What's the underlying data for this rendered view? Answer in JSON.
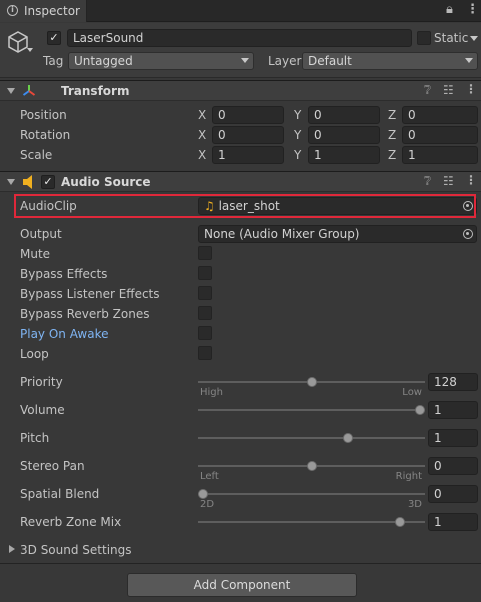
{
  "window": {
    "tab_title": "Inspector"
  },
  "header": {
    "object_name": "LaserSound",
    "static_label": "Static",
    "tag_label": "Tag",
    "tag_value": "Untagged",
    "layer_label": "Layer",
    "layer_value": "Default"
  },
  "transform": {
    "title": "Transform",
    "rows": [
      {
        "label": "Position",
        "x": "0",
        "y": "0",
        "z": "0"
      },
      {
        "label": "Rotation",
        "x": "0",
        "y": "0",
        "z": "0"
      },
      {
        "label": "Scale",
        "x": "1",
        "y": "1",
        "z": "1"
      }
    ],
    "axis": {
      "x": "X",
      "y": "Y",
      "z": "Z"
    }
  },
  "audio_source": {
    "title": "Audio Source",
    "audio_clip_label": "AudioClip",
    "audio_clip_value": "laser_shot",
    "output_label": "Output",
    "output_value": "None (Audio Mixer Group)",
    "mute_label": "Mute",
    "bypass_effects_label": "Bypass Effects",
    "bypass_listener_label": "Bypass Listener Effects",
    "bypass_reverb_label": "Bypass Reverb Zones",
    "play_on_awake_label": "Play On Awake",
    "loop_label": "Loop",
    "priority": {
      "label": "Priority",
      "value": "128",
      "min_label": "High",
      "max_label": "Low",
      "fraction": 0.5
    },
    "volume": {
      "label": "Volume",
      "value": "1",
      "fraction": 1.0
    },
    "pitch": {
      "label": "Pitch",
      "value": "1",
      "fraction": 0.67
    },
    "stereo_pan": {
      "label": "Stereo Pan",
      "value": "0",
      "min_label": "Left",
      "max_label": "Right",
      "fraction": 0.5
    },
    "spatial_blend": {
      "label": "Spatial Blend",
      "value": "0",
      "min_label": "2D",
      "max_label": "3D",
      "fraction": 0.0
    },
    "reverb_zone_mix": {
      "label": "Reverb Zone Mix",
      "value": "1",
      "fraction": 0.91
    },
    "sound_settings_label": "3D Sound Settings"
  },
  "footer": {
    "add_component_label": "Add Component"
  },
  "colors": {
    "background": "#383838",
    "highlight": "#e0283a",
    "link_blue": "#7fb4f2",
    "audio_icon": "#f0b020"
  }
}
